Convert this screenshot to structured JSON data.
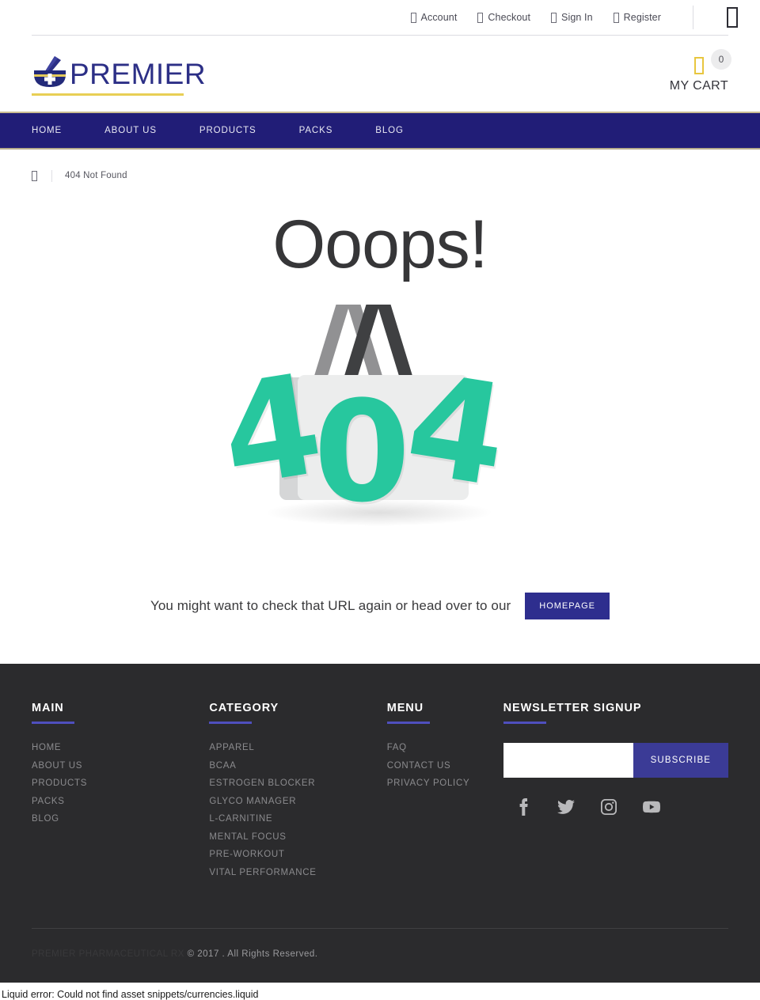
{
  "topbar": {
    "links": [
      {
        "label": "Account",
        "icon": "user-icon"
      },
      {
        "label": "Checkout",
        "icon": "cart-icon"
      },
      {
        "label": "Sign In",
        "icon": "signin-icon"
      },
      {
        "label": "Register",
        "icon": "register-icon"
      }
    ],
    "menu_icon": "menu-icon"
  },
  "header": {
    "logo_text": "PREMIER",
    "logo_icon": "mortar-and-pestle-icon",
    "cart": {
      "count": "0",
      "label": "MY CART",
      "icon": "shopping-cart-icon"
    }
  },
  "nav": {
    "items": [
      {
        "label": "HOME"
      },
      {
        "label": "ABOUT US"
      },
      {
        "label": "PRODUCTS"
      },
      {
        "label": "PACKS"
      },
      {
        "label": "BLOG"
      }
    ]
  },
  "breadcrumb": {
    "home_icon": "home-icon",
    "current": "404 Not Found"
  },
  "error_page": {
    "title": "Ooops!",
    "graphic": "shopping-bag-404-illustration",
    "digits": {
      "left": "4",
      "middle": "0",
      "right": "4"
    },
    "message": "You might want to check that URL again or head over to our",
    "button_label": "HOMEPAGE"
  },
  "footer": {
    "columns": [
      {
        "title": "MAIN",
        "links": [
          "HOME",
          "ABOUT US",
          "PRODUCTS",
          "PACKS",
          "BLOG"
        ]
      },
      {
        "title": "CATEGORY",
        "links": [
          "APPAREL",
          "BCAA",
          "ESTROGEN BLOCKER",
          "GLYCO MANAGER",
          "L-CARNITINE",
          "MENTAL FOCUS",
          "PRE-WORKOUT",
          "VITAL PERFORMANCE"
        ]
      },
      {
        "title": "MENU",
        "links": [
          "FAQ",
          "CONTACT US",
          "PRIVACY POLICY"
        ]
      }
    ],
    "newsletter": {
      "title": "NEWSLETTER SIGNUP",
      "input_value": "",
      "input_placeholder": "",
      "button_label": "SUBSCRIBE"
    },
    "socials": [
      {
        "name": "facebook-icon"
      },
      {
        "name": "twitter-icon"
      },
      {
        "name": "instagram-icon"
      },
      {
        "name": "youtube-icon"
      }
    ],
    "copyright_brand": "PREMIER PHARMACEUTICAL RX",
    "copyright_rest": " © 2017 . All Rights Reserved."
  },
  "liquid_error": "Liquid error: Could not find asset snippets/currencies.liquid",
  "colors": {
    "nav_navy": "#211d77",
    "logo_navy": "#2c2f86",
    "logo_gold": "#e8cf55",
    "accent_teal": "#27c79e",
    "button_indigo": "#2e2e8e",
    "footer_bg": "#2b2b2d",
    "footer_rule": "#4f4fbe"
  }
}
